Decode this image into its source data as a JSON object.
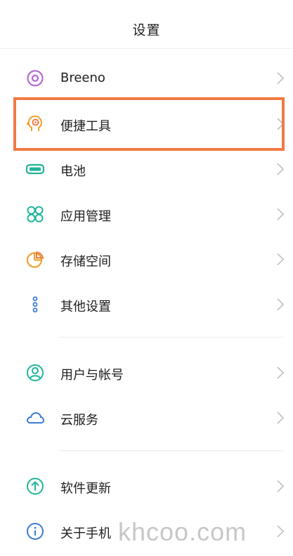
{
  "header": {
    "title": "设置"
  },
  "items": [
    {
      "id": "breeno",
      "label": "Breeno",
      "icon": "breeno-ring-icon",
      "color": "#b46ad6"
    },
    {
      "id": "shortcuts",
      "label": "便捷工具",
      "icon": "head-gear-icon",
      "color": "#f0a030"
    },
    {
      "id": "battery",
      "label": "电池",
      "icon": "battery-icon",
      "color": "#1fb59a"
    },
    {
      "id": "apps",
      "label": "应用管理",
      "icon": "app-grid-icon",
      "color": "#1fb59a"
    },
    {
      "id": "storage",
      "label": "存储空间",
      "icon": "pie-chart-icon",
      "color": "#f0a030"
    },
    {
      "id": "other",
      "label": "其他设置",
      "icon": "dots-icon",
      "color": "#3a7bd5"
    },
    {
      "id": "account",
      "label": "用户与帐号",
      "icon": "user-icon",
      "color": "#1fb59a"
    },
    {
      "id": "cloud",
      "label": "云服务",
      "icon": "cloud-icon",
      "color": "#3a7bd5"
    },
    {
      "id": "update",
      "label": "软件更新",
      "icon": "arrow-up-circle-icon",
      "color": "#1fb59a"
    },
    {
      "id": "about",
      "label": "关于手机",
      "icon": "info-icon",
      "color": "#3a7bd5"
    }
  ],
  "highlight_color": "#f07a44",
  "watermark": "khcoo.com"
}
